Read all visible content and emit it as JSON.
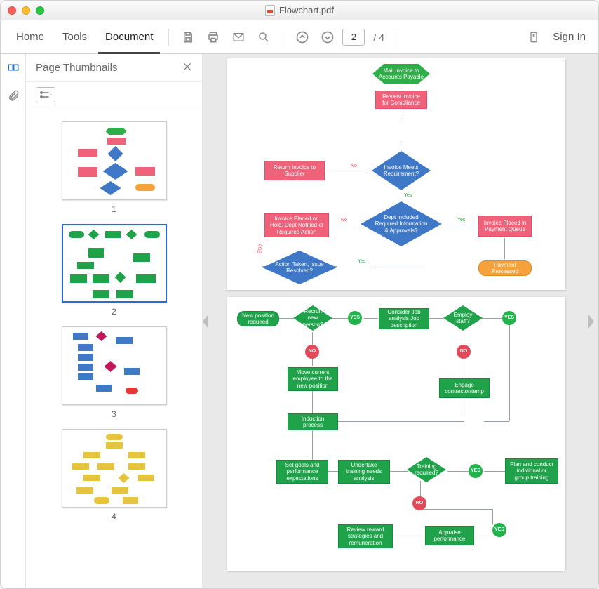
{
  "window": {
    "title": "Flowchart.pdf"
  },
  "tabs": {
    "home": "Home",
    "tools": "Tools",
    "document": "Document"
  },
  "toolbar": {
    "page_current": "2",
    "page_total": "/ 4",
    "sign_in": "Sign In"
  },
  "sidepanel": {
    "title": "Page Thumbnails"
  },
  "thumbnails": [
    {
      "label": "1",
      "selected": false
    },
    {
      "label": "2",
      "selected": true
    },
    {
      "label": "3",
      "selected": false
    },
    {
      "label": "4",
      "selected": false
    }
  ],
  "page1": {
    "n1": "Mail Invoice to Accounts Payable",
    "n2": "Review Invoice for Compliance",
    "n3": "Invoice Meets Requirement?",
    "n4": "Return Invoice to Supplier",
    "n5": "Dept Included Required Information & Approvals?",
    "n6": "Invoice Placed on Hold, Dept Notified of Required Action",
    "n7": "Invoice Placed in Payment Queue",
    "n8": "Action Taken, Issue Resolved?",
    "n9": "Payment Processed",
    "yes": "Yes",
    "no": "No",
    "else": "Else"
  },
  "page2": {
    "a1": "New position required",
    "a2": "Recruit new person?",
    "a3": "Consider Job analysis Job description",
    "a4": "Employ staff?",
    "a5": "Move current employee to the new position",
    "a6": "Induction process",
    "a7": "Engage contractor/temp",
    "a8": "Set goals and performance expectations",
    "a9": "Undertake training needs analysis",
    "a10": "Training required?",
    "a11": "Plan and conduct individual or group training",
    "a12": "Review reward strategies and remuneration",
    "a13": "Appraise performance",
    "yes": "YES",
    "no": "NO"
  }
}
